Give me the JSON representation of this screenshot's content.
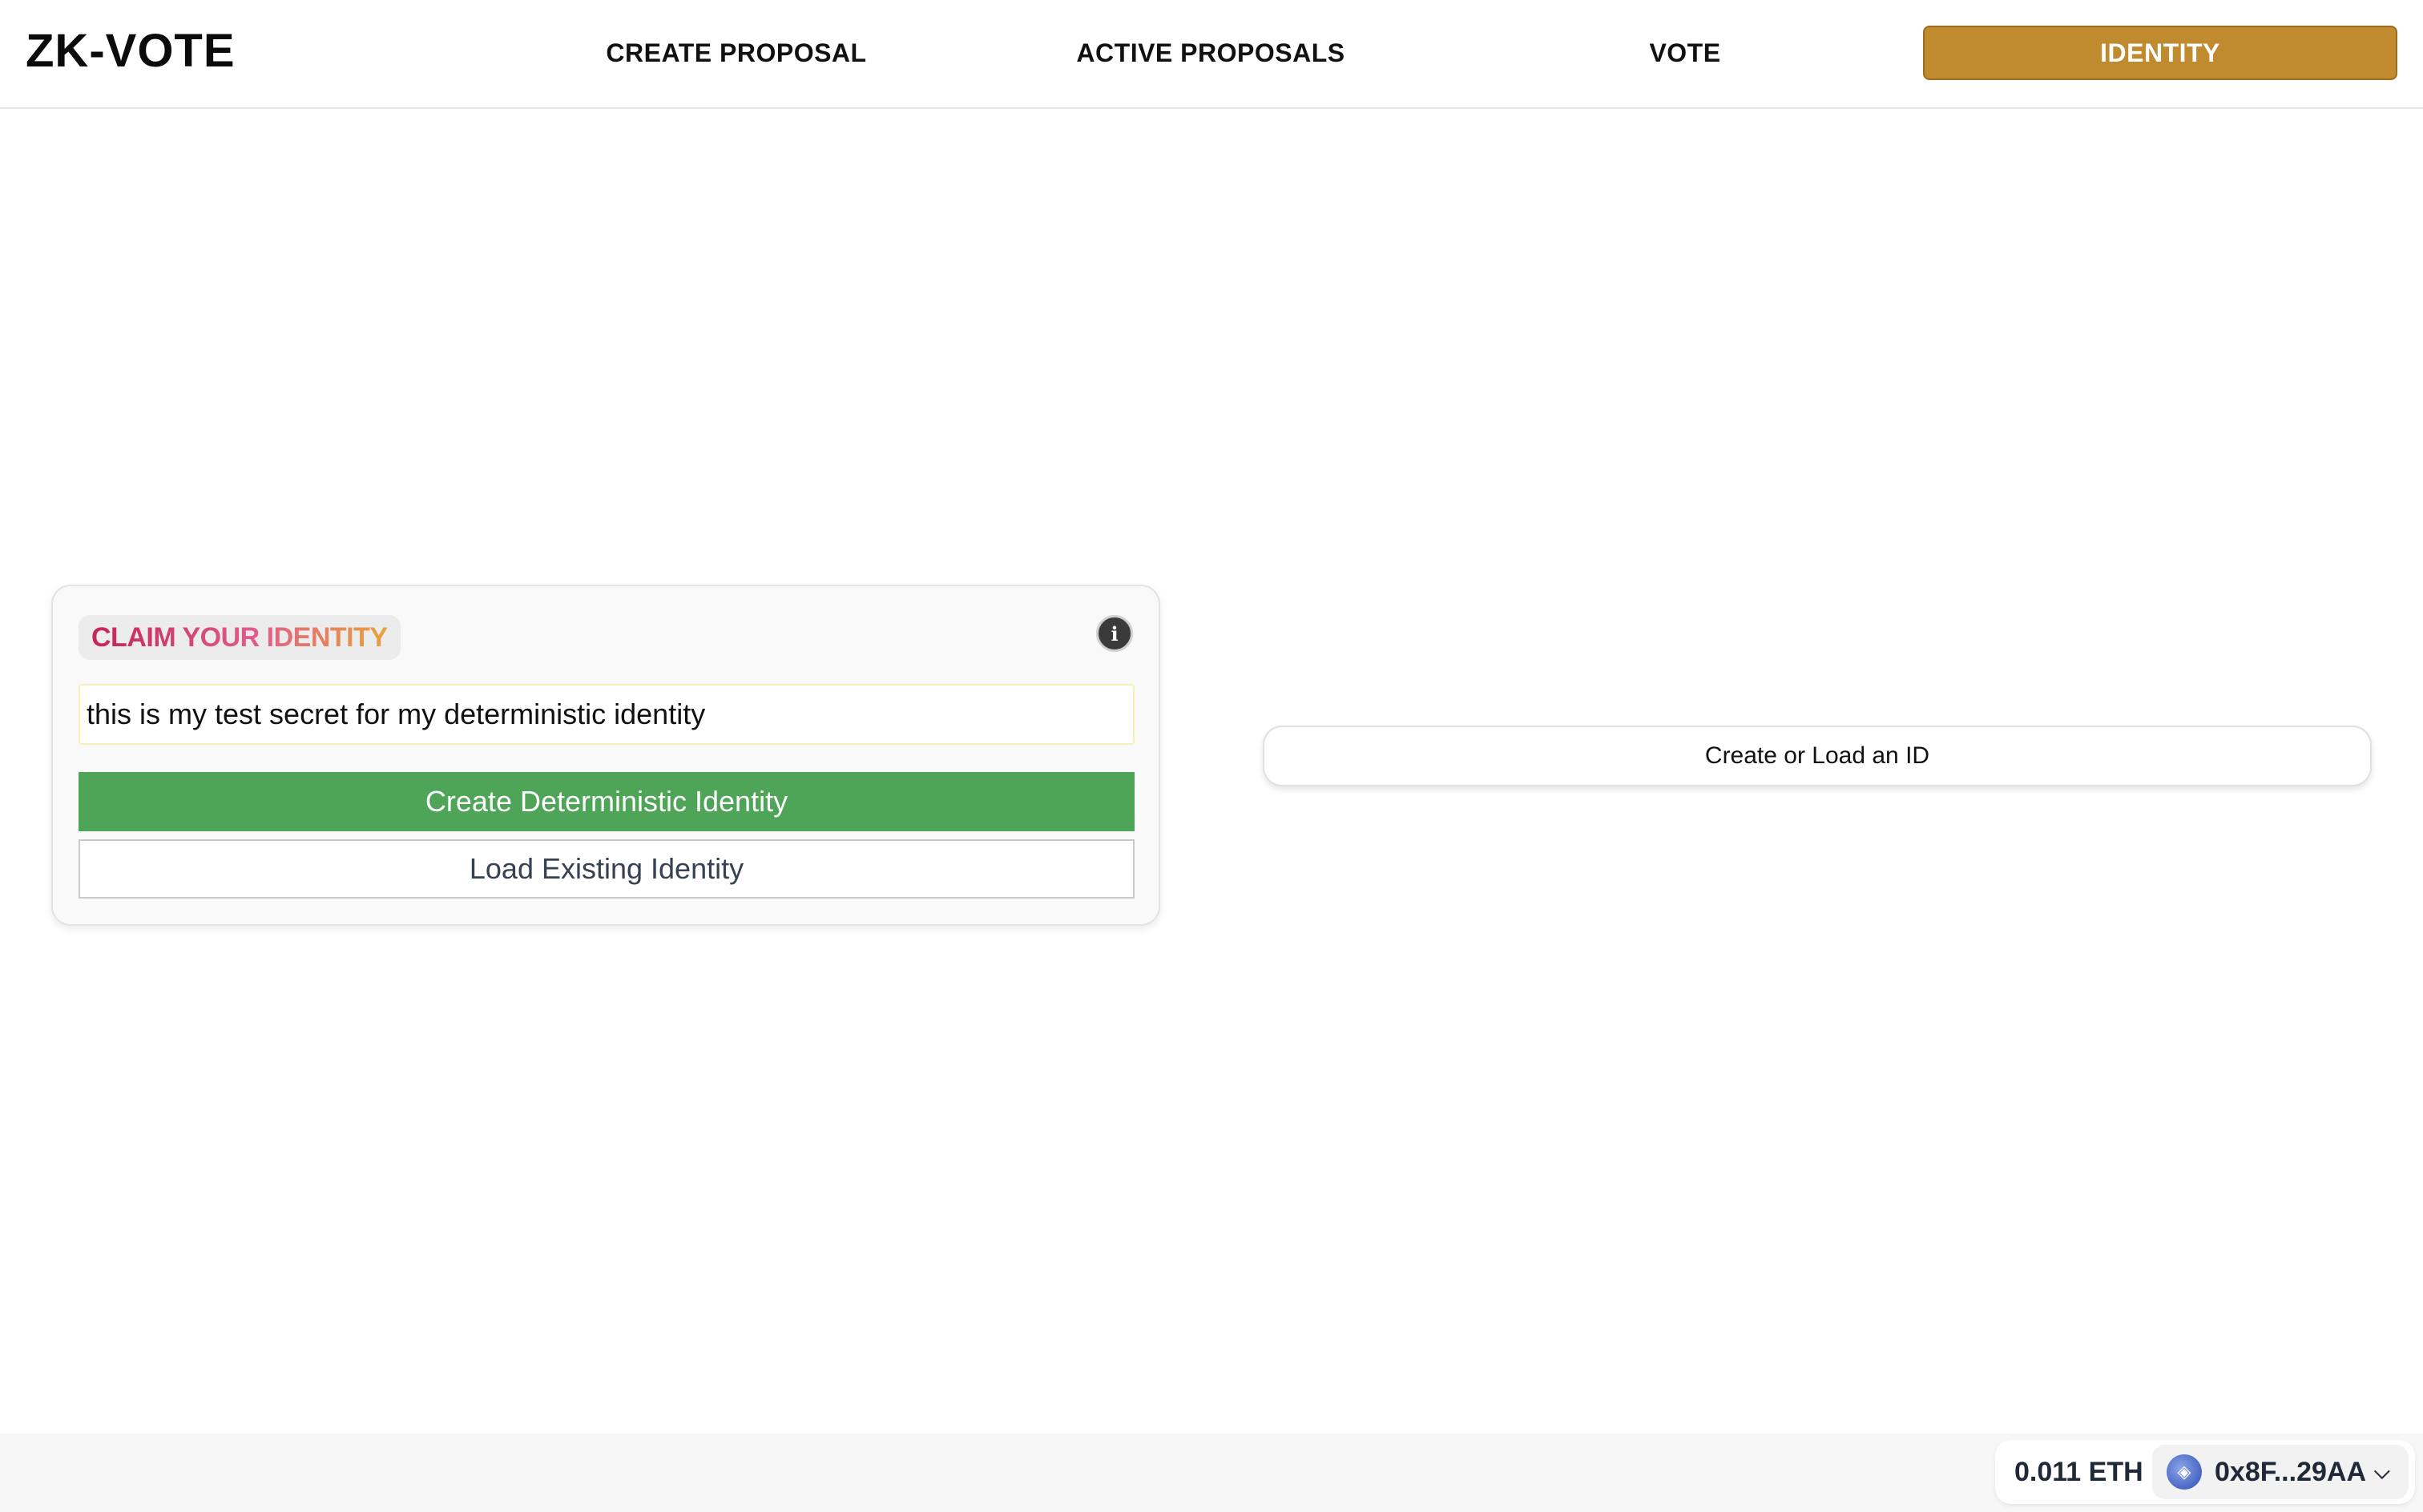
{
  "header": {
    "brand": "ZK-VOTE",
    "nav": {
      "create_proposal": "CREATE PROPOSAL",
      "active_proposals": "ACTIVE PROPOSALS",
      "vote": "VOTE",
      "identity": "IDENTITY"
    },
    "active_tab": "identity",
    "active_color": "#c08a2f"
  },
  "identity_card": {
    "title": "CLAIM YOUR IDENTITY",
    "info_icon": "info-icon",
    "secret_value": "this is my test secret for my deterministic identity",
    "create_button": "Create Deterministic Identity",
    "create_button_color": "#4ea457",
    "load_button": "Load Existing Identity"
  },
  "id_panel": {
    "label": "Create or Load an ID"
  },
  "wallet": {
    "balance": "0.011 ETH",
    "avatar_icon": "ens-avatar-icon",
    "address": "0x8F...29AA",
    "dropdown_icon": "chevron-down-icon"
  }
}
